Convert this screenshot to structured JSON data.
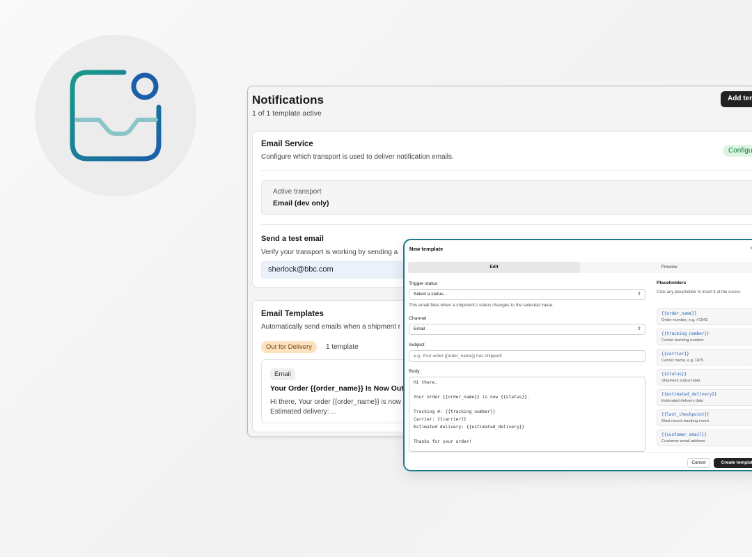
{
  "app_icon": {
    "name": "inbox-notification-icon",
    "colors": {
      "teal": "#1a9a8a",
      "blue": "#1a5fa8",
      "light": "#8ac4c8"
    }
  },
  "window": {
    "title": "Notifications",
    "subtitle": "1 of 1 template active",
    "add_button": "Add template"
  },
  "email_service": {
    "title": "Email Service",
    "description": "Configure which transport is used to deliver notification emails.",
    "status": "Configured",
    "transport_label": "Active transport",
    "transport_value": "Email (dev only)",
    "test_title": "Send a test email",
    "test_description": "Verify your transport is working by sending a",
    "test_email": "sherlock@bbc.com"
  },
  "email_templates": {
    "title": "Email Templates",
    "description": "Automatically send emails when a shipment r",
    "status_badge": "Out for Delivery",
    "count": "1 template",
    "card": {
      "channel": "Email",
      "title": "Your Order {{order_name}} Is Now Out",
      "body_line1": "Hi there, Your order {{order_name}} is now",
      "body_line2": "Estimated delivery: ..."
    }
  },
  "modal": {
    "title": "New template",
    "close": "×",
    "tabs": {
      "edit": "Edit",
      "preview": "Preview"
    },
    "trigger_label": "Trigger status",
    "trigger_placeholder": "Select a status...",
    "trigger_help": "This email fires when a shipment's status changes to the selected value.",
    "channel_label": "Channel",
    "channel_value": "Email",
    "subject_label": "Subject",
    "subject_placeholder": "e.g. Your order {{order_name}} has shipped!",
    "body_label": "Body",
    "body_lines": [
      "Hi there,",
      "",
      "Your order {{order_name}} is now {{status}}.",
      "",
      "Tracking #: {{tracking_number}}",
      "Carrier: {{carrier}}",
      "Estimated delivery: {{estimated_delivery}}",
      "",
      "Thanks for your order!"
    ],
    "placeholders_title": "Placeholders",
    "placeholders_help": "Click any placeholder to insert it at the cursor.",
    "placeholders": [
      {
        "code": "{{order_name}}",
        "desc": "Order number, e.g. #1042"
      },
      {
        "code": "{{tracking_number}}",
        "desc": "Carrier tracking number"
      },
      {
        "code": "{{carrier}}",
        "desc": "Carrier name, e.g. UPS"
      },
      {
        "code": "{{status}}",
        "desc": "Shipment status label"
      },
      {
        "code": "{{estimated_delivery}}",
        "desc": "Estimated delivery date"
      },
      {
        "code": "{{last_checkpoint}}",
        "desc": "Most recent tracking event"
      },
      {
        "code": "{{customer_email}}",
        "desc": "Customer email address"
      }
    ],
    "cancel": "Cancel",
    "create": "Create template"
  }
}
